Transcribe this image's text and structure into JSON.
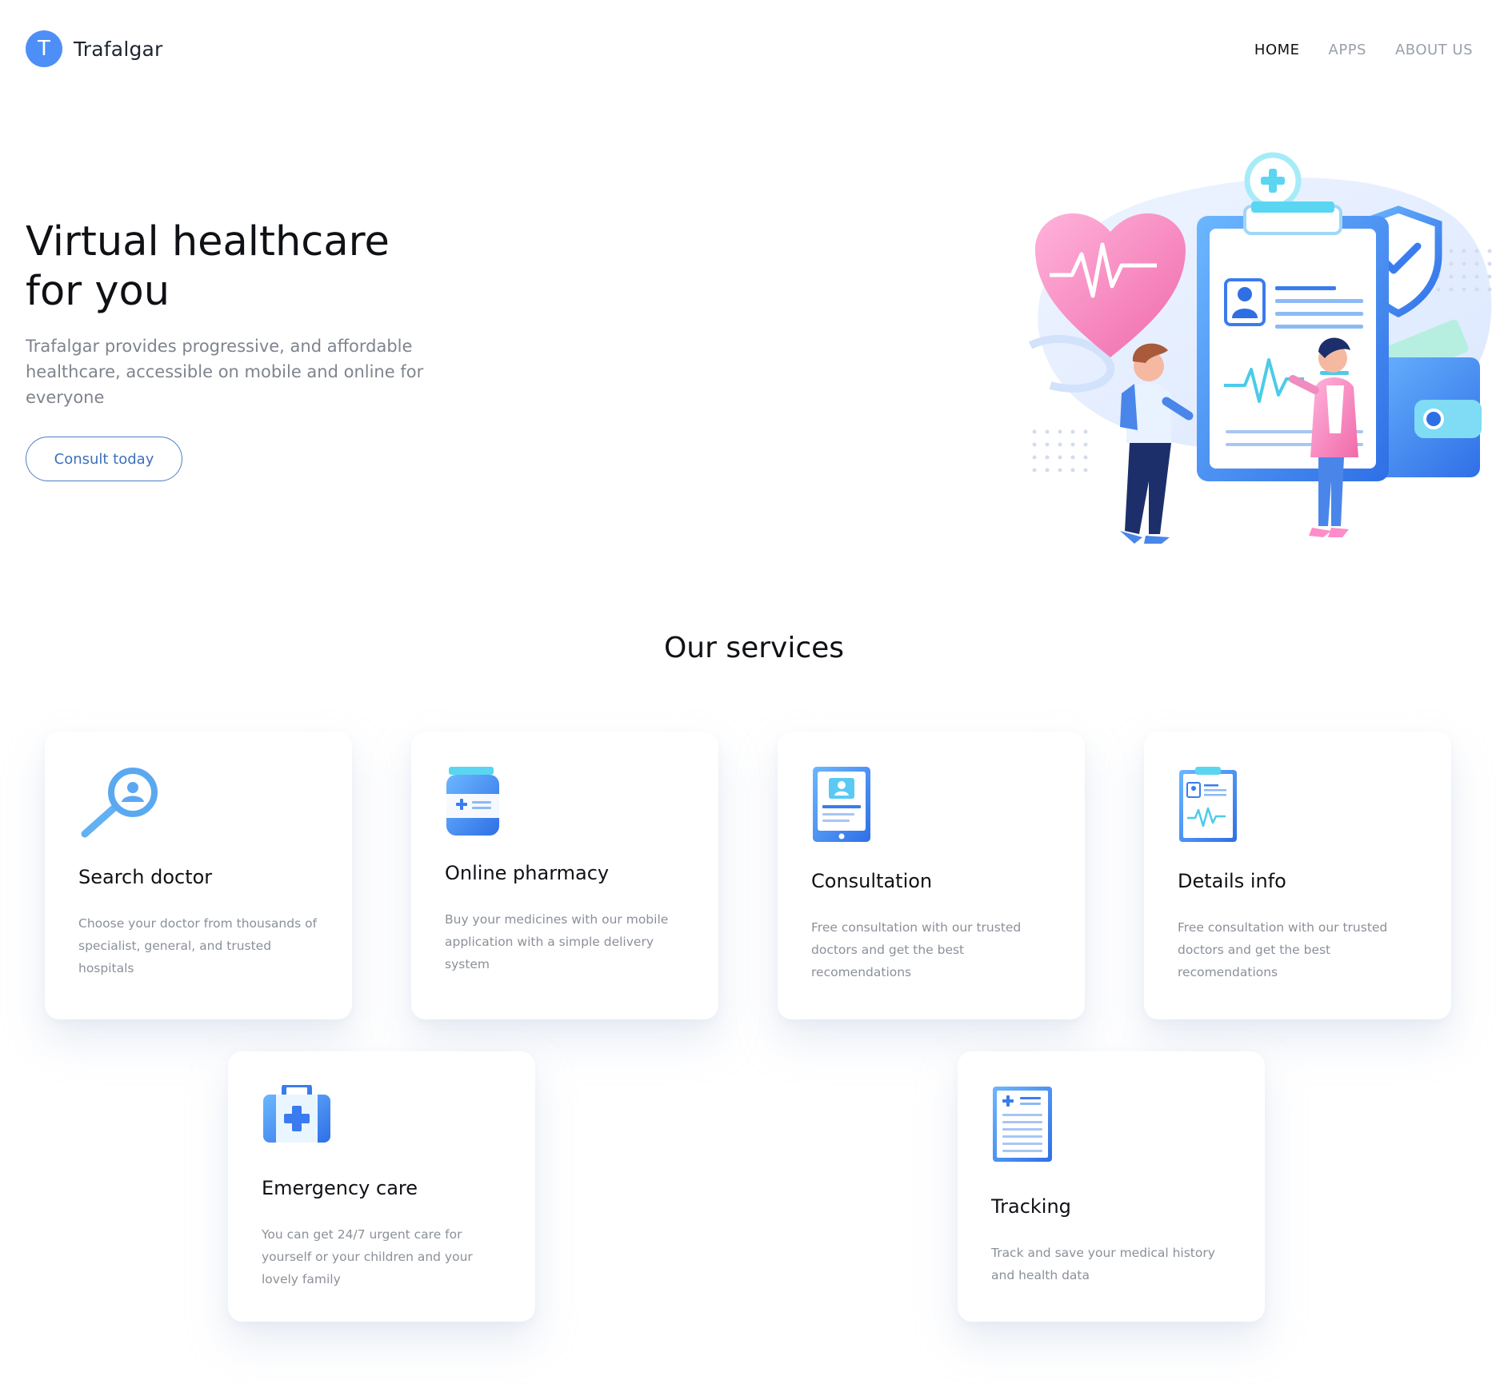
{
  "brand": {
    "logo_letter": "T",
    "name": "Trafalgar",
    "color": "#4d8ff7"
  },
  "nav": {
    "items": [
      {
        "label": "HOME",
        "active": true
      },
      {
        "label": "APPS",
        "active": false
      },
      {
        "label": "ABOUT US",
        "active": false
      }
    ]
  },
  "hero": {
    "title_line1": "Virtual healthcare",
    "title_line2": "for you",
    "description": "Trafalgar provides progressive, and affordable healthcare, accessible on mobile and online for everyone",
    "cta_label": "Consult today",
    "illustration": "healthcare-illustration"
  },
  "services": {
    "title": "Our services",
    "items": [
      {
        "icon": "magnifier-doctor-icon",
        "title": "Search doctor",
        "description": "Choose your doctor from thousands of specialist, general, and trusted hospitals"
      },
      {
        "icon": "medicine-bottle-icon",
        "title": "Online pharmacy",
        "description": "Buy your medicines with our mobile application with a simple delivery system"
      },
      {
        "icon": "tablet-profile-icon",
        "title": "Consultation",
        "description": "Free consultation with our trusted doctors and get the best recomendations"
      },
      {
        "icon": "clipboard-info-icon",
        "title": "Details info",
        "description": "Free consultation with our trusted doctors and get the best recomendations"
      },
      {
        "icon": "first-aid-kit-icon",
        "title": "Emergency care",
        "description": "You can get 24/7 urgent care for yourself or your children and your lovely family"
      },
      {
        "icon": "medical-document-icon",
        "title": "Tracking",
        "description": "Track and save your medical history and health data"
      }
    ]
  },
  "colors": {
    "accent": "#4d8ff7",
    "button_border": "#4b7fc5",
    "muted_text": "#8b9099",
    "pink": "#f58fc2",
    "cyan": "#5ad6f2"
  }
}
